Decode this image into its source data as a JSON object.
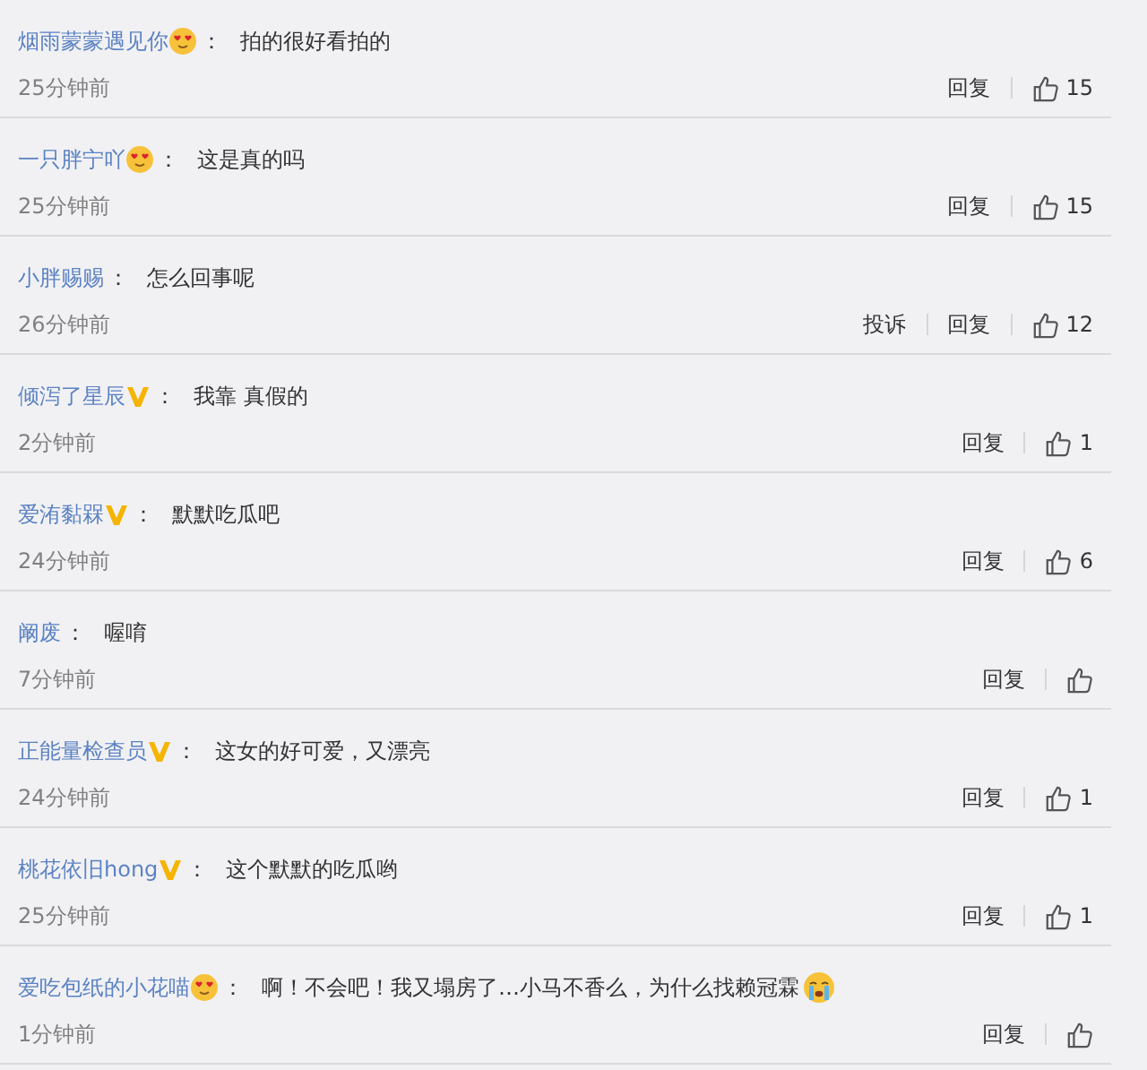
{
  "comments": [
    {
      "user": "烟雨蒙蒙遇见你",
      "badge": {
        "kind": "heart-face"
      },
      "colon": "：",
      "text": "拍的很好看拍的",
      "time": "25分钟前",
      "actions": [
        "回复"
      ],
      "likes": "15"
    },
    {
      "user": "一只胖宁吖",
      "badge": {
        "kind": "heart-face"
      },
      "colon": "：",
      "text": "这是真的吗",
      "time": "25分钟前",
      "actions": [
        "回复"
      ],
      "likes": "15"
    },
    {
      "user": "小胖赐赐",
      "colon": "：",
      "text": "怎么回事呢",
      "time": "26分钟前",
      "actions": [
        "投诉",
        "回复"
      ],
      "likes": "12"
    },
    {
      "user": "倾泻了星辰",
      "badge": {
        "kind": "v"
      },
      "colon": "：",
      "text": "我靠 真假的",
      "time": "2分钟前",
      "actions": [
        "回复"
      ],
      "likes": "1"
    },
    {
      "user": "爱洧黏槑",
      "badge": {
        "kind": "v"
      },
      "colon": "：",
      "text": "默默吃瓜吧",
      "time": "24分钟前",
      "actions": [
        "回复"
      ],
      "likes": "6"
    },
    {
      "user": "阚废",
      "colon": "：",
      "text": "喔唷",
      "time": "7分钟前",
      "actions": [
        "回复"
      ]
    },
    {
      "user": "正能量检查员",
      "badge": {
        "kind": "v"
      },
      "colon": "：",
      "text": "这女的好可爱，又漂亮",
      "time": "24分钟前",
      "actions": [
        "回复"
      ],
      "likes": "1"
    },
    {
      "user": "桃花依旧hong",
      "badge": {
        "kind": "v"
      },
      "colon": "：",
      "text": "这个默默的吃瓜哟",
      "time": "25分钟前",
      "actions": [
        "回复"
      ],
      "likes": "1"
    },
    {
      "user": "爱吃包纸的小花喵",
      "badge": {
        "kind": "heart-face"
      },
      "colon": "：",
      "text": "啊！不会吧！我又塌房了…小马不香么，为什么找赖冠霖",
      "end_icon": {
        "kind": "crying-face"
      },
      "time": "1分钟前",
      "actions": [
        "回复"
      ]
    }
  ]
}
